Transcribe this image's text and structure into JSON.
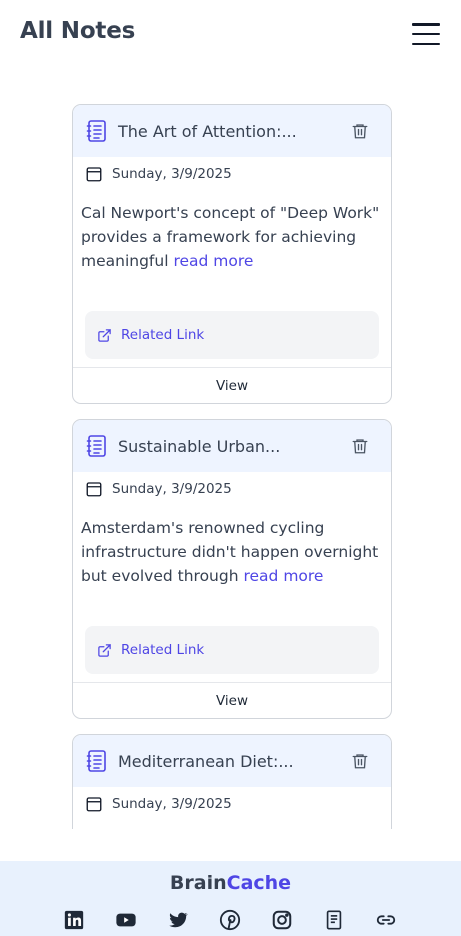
{
  "header": {
    "title": "All Notes",
    "menu_icon": "hamburger-menu-icon"
  },
  "notes": [
    {
      "title": "The Art of Attention:...",
      "date": "Sunday, 3/9/2025",
      "excerpt": "Cal Newport's concept of \"Deep Work\" provides a framework for achieving meaningful",
      "read_more": "read more",
      "link_label": "Related Link",
      "view_label": "View"
    },
    {
      "title": "Sustainable Urban...",
      "date": "Sunday, 3/9/2025",
      "excerpt": "Amsterdam's renowned cycling infrastructure didn't happen overnight but evolved through",
      "read_more": "read more",
      "link_label": "Related Link",
      "view_label": "View"
    },
    {
      "title": "Mediterranean Diet:...",
      "date": "Sunday, 3/9/2025"
    }
  ],
  "footer": {
    "brand_primary": "Brain",
    "brand_accent": "Cache",
    "socials": [
      "linkedin-icon",
      "youtube-icon",
      "twitter-icon",
      "pinterest-icon",
      "instagram-icon",
      "document-icon",
      "link-icon"
    ]
  },
  "colors": {
    "accent": "#4f46e5",
    "card_header": "#eef4ff",
    "footer_bg": "#e8f1fd"
  }
}
